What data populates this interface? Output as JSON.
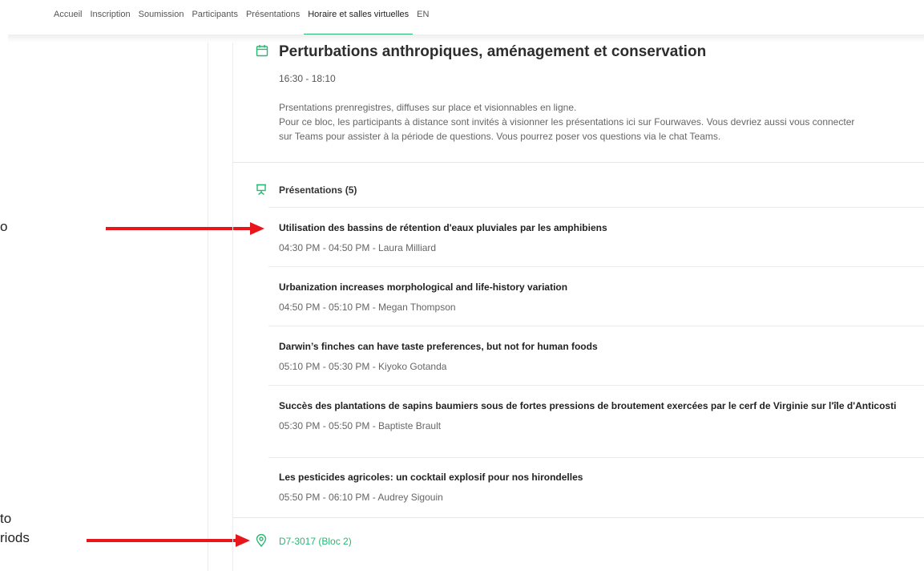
{
  "nav": {
    "items": [
      {
        "label": "Accueil"
      },
      {
        "label": "Inscription"
      },
      {
        "label": "Soumission"
      },
      {
        "label": "Participants"
      },
      {
        "label": "Présentations"
      },
      {
        "label": "Horaire et salles virtuelles",
        "active": true
      },
      {
        "label": "EN"
      }
    ]
  },
  "annotations": {
    "fragment_top": "o",
    "fragment_bottom_1": "to",
    "fragment_bottom_2": "riods",
    "arrow_color": "#e8161a"
  },
  "session": {
    "title": "Perturbations anthropiques, aménagement et conservation",
    "time": "16:30 - 18:10",
    "description": [
      "Prsentations prenregistres, diffuses sur place et visionnables en ligne.",
      "Pour ce bloc, les participants à distance sont invités à visionner les présentations ici sur Fourwaves. Vous devriez aussi vous connecter",
      "sur Teams pour assister à la période de questions. Vous pourrez poser vos questions via le chat Teams."
    ]
  },
  "presentations": {
    "header": "Présentations (5)",
    "items": [
      {
        "title": "Utilisation des bassins de rétention d'eaux pluviales par les amphibiens",
        "meta": "04:30 PM - 04:50 PM - Laura Milliard"
      },
      {
        "title": "Urbanization increases morphological and life-history variation",
        "meta": "04:50 PM - 05:10 PM - Megan Thompson"
      },
      {
        "title": "Darwin’s finches can have taste preferences, but not for human foods",
        "meta": "05:10 PM - 05:30 PM - Kiyoko Gotanda"
      },
      {
        "title": "Succès des plantations de sapins baumiers sous de fortes pressions de broutement exercées par le cerf de Virginie sur l'île d'Anticosti",
        "meta": "05:30 PM - 05:50 PM - Baptiste Brault"
      },
      {
        "title": "Les pesticides agricoles: un cocktail explosif pour nos hirondelles",
        "meta": "05:50 PM - 06:10 PM - Audrey Sigouin"
      }
    ]
  },
  "location": {
    "label": "D7-3017 (Bloc 2)"
  },
  "colors": {
    "accent": "#2bb673",
    "arrow": "#e8161a"
  }
}
